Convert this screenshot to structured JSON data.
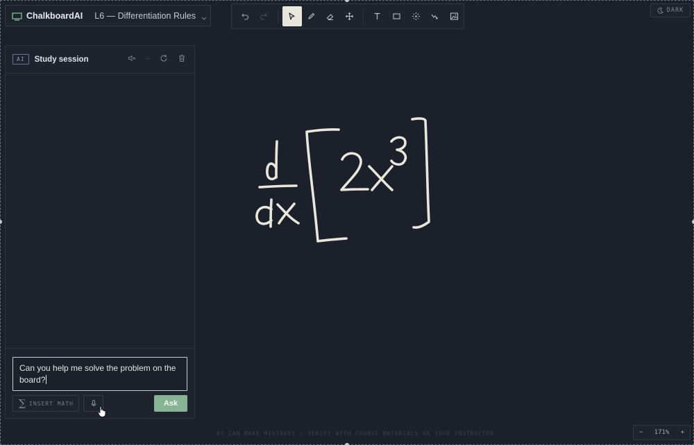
{
  "header": {
    "app_name": "ChalkboardAI",
    "lesson_title": "L6 — Differentiation Rules"
  },
  "toolbar": {
    "tools": [
      "undo-icon",
      "redo-icon",
      "select-icon",
      "pen-icon",
      "eraser-icon",
      "move-icon",
      "text-icon",
      "rectangle-icon",
      "laser-icon",
      "connector-icon",
      "image-icon"
    ],
    "active_tool": "select"
  },
  "theme": {
    "label": "DARK"
  },
  "ai_panel": {
    "badge": "AI",
    "title": "Study session",
    "question_text": "Can you help me solve the problem on the board?",
    "insert_math_label": "INSERT MATH",
    "ask_label": "Ask"
  },
  "board": {
    "handwriting": "d/dx [2x^3]"
  },
  "footer": {
    "note": "AI CAN MAKE MISTAKES — VERIFY WITH COURSE MATERIALS OR YOUR INSTRUCTOR"
  },
  "zoom": {
    "minus": "−",
    "level": "171%",
    "plus": "+"
  },
  "colors": {
    "background": "#1b202a",
    "accent": "#86b494",
    "chalk": "#e9e6dc"
  }
}
